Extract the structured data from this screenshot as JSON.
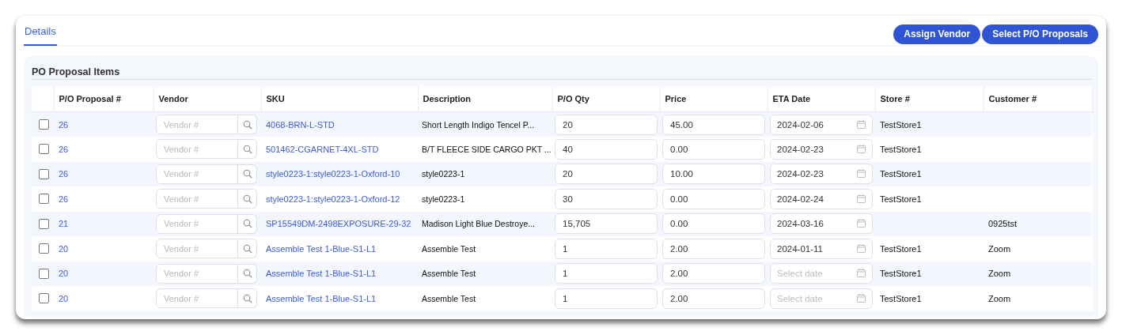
{
  "tabs": [
    {
      "label": "Details",
      "selected": true
    }
  ],
  "actions": [
    "Assign Vendor",
    "Select P/O Proposals"
  ],
  "panel": {
    "title": "PO Proposal Items",
    "columns": [
      "P/O Proposal #",
      "Vendor",
      "SKU",
      "Description",
      "P/O Qty",
      "Price",
      "ETA Date",
      "Store #",
      "Customer #"
    ],
    "rows": [
      {
        "checked": false,
        "proposal": "26",
        "vendor_placeholder": "Vendor #",
        "sku": "4068-BRN-L-STD",
        "description": "Short Length Indigo Tencel P...",
        "qty": "20",
        "price": "45.00",
        "eta_date": "2024-02-06",
        "store": "TestStore1"
      },
      {
        "checked": false,
        "proposal": "26",
        "vendor_placeholder": "Vendor #",
        "sku": "501462-CGARNET-4XL-STD",
        "description": "B/T FLEECE SIDE CARGO PKT ...",
        "qty": "40",
        "price": "0.00",
        "eta_date": "2024-02-23",
        "store": "TestStore1"
      },
      {
        "checked": false,
        "proposal": "26",
        "vendor_placeholder": "Vendor #",
        "sku": "style0223-1:style0223-1-Oxford-10",
        "description": "style0223-1",
        "qty": "20",
        "price": "10.00",
        "eta_date": "2024-02-23",
        "store": "TestStore1"
      },
      {
        "checked": false,
        "proposal": "26",
        "vendor_placeholder": "Vendor #",
        "sku": "style0223-1:style0223-1-Oxford-12",
        "description": "style0223-1",
        "qty": "30",
        "price": "0.00",
        "eta_date": "2024-02-24",
        "store": "TestStore1"
      },
      {
        "checked": false,
        "proposal": "21",
        "vendor_placeholder": "Vendor #",
        "sku": "SP15549DM-2498EXPOSURE-29-32",
        "description": "Madison Light Blue Destroye...",
        "qty": "15,705",
        "price": "0.00",
        "eta_date": "2024-03-16",
        "customer": "0925tst"
      },
      {
        "checked": false,
        "proposal": "20",
        "vendor_placeholder": "Vendor #",
        "sku": "Assemble Test 1-Blue-S1-L1",
        "description": "Assemble Test",
        "qty": "1",
        "price": "2.00",
        "eta_date": "2024-01-11",
        "store": "TestStore1",
        "customer": "Zoom"
      },
      {
        "checked": false,
        "proposal": "20",
        "vendor_placeholder": "Vendor #",
        "sku": "Assemble Test 1-Blue-S1-L1",
        "description": "Assemble Test",
        "qty": "1",
        "price": "2.00",
        "eta_placeholder": "Select date",
        "store": "TestStore1",
        "customer": "Zoom"
      },
      {
        "checked": false,
        "proposal": "20",
        "vendor_placeholder": "Vendor #",
        "sku": "Assemble Test 1-Blue-S1-L1",
        "description": "Assemble Test",
        "qty": "1",
        "price": "2.00",
        "eta_placeholder": "Select date",
        "store": "TestStore1",
        "customer": "Zoom"
      }
    ]
  }
}
